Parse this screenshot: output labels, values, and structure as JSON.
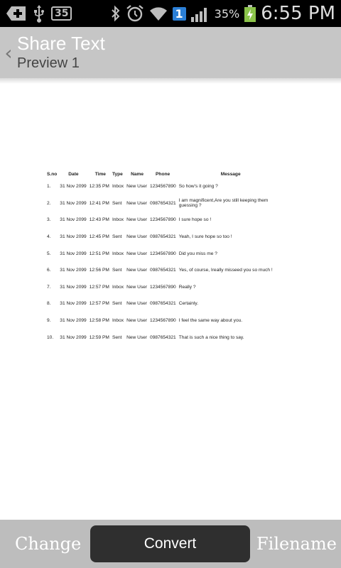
{
  "status_bar": {
    "notification_count": "35",
    "sim_badge": "1",
    "battery_percent": "35%",
    "time": "6:55 PM",
    "icons": [
      "add-icon",
      "usb-icon",
      "bluetooth-icon",
      "alarm-icon",
      "wifi-icon",
      "signal-icon",
      "battery-icon"
    ]
  },
  "action_bar": {
    "title": "Share Text",
    "subtitle": "Preview  1",
    "back_icon": "chevron-left-icon"
  },
  "table": {
    "headers": [
      "S.no",
      "Date",
      "Time",
      "Type",
      "Name",
      "Phone",
      "Message"
    ],
    "rows": [
      {
        "sno": "1.",
        "date": "31 Nov 2099",
        "time": "12:35 PM",
        "type": "Inbox",
        "name": "New User",
        "phone": "1234567890",
        "message": "So how's it going ?"
      },
      {
        "sno": "2.",
        "date": "31 Nov 2099",
        "time": "12:41 PM",
        "type": "Sent",
        "name": "New User",
        "phone": "0987654321",
        "message": "I am magnificent,Are you still keeping them guessing ?"
      },
      {
        "sno": "3.",
        "date": "31 Nov 2099",
        "time": "12:43 PM",
        "type": "Inbox",
        "name": "New User",
        "phone": "1234567890",
        "message": "I sure hope so !"
      },
      {
        "sno": "4.",
        "date": "31 Nov 2099",
        "time": "12:45 PM",
        "type": "Sent",
        "name": "New User",
        "phone": "0987654321",
        "message": "Yeah, I sure hope so too !"
      },
      {
        "sno": "5.",
        "date": "31 Nov 2099",
        "time": "12:51 PM",
        "type": "Inbox",
        "name": "New User",
        "phone": "1234567890",
        "message": "Did you miss me ?"
      },
      {
        "sno": "6.",
        "date": "31 Nov 2099",
        "time": "12:56 PM",
        "type": "Sent",
        "name": "New User",
        "phone": "0987654321",
        "message": "Yes, of course, Ireally misseed you so much !"
      },
      {
        "sno": "7.",
        "date": "31 Nov 2099",
        "time": "12:57 PM",
        "type": "Inbox",
        "name": "New User",
        "phone": "1234567890",
        "message": "Really ?"
      },
      {
        "sno": "8.",
        "date": "31 Nov 2099",
        "time": "12:57 PM",
        "type": "Sent",
        "name": "New User",
        "phone": "0987654321",
        "message": "Certainly."
      },
      {
        "sno": "9.",
        "date": "31 Nov 2099",
        "time": "12:58 PM",
        "type": "Inbox",
        "name": "New User",
        "phone": "1234567890",
        "message": "I feel the same way about you."
      },
      {
        "sno": "10.",
        "date": "31 Nov 2099",
        "time": "12:59 PM",
        "type": "Sent",
        "name": "New User",
        "phone": "0987654321",
        "message": "That is such a nice thing to say."
      }
    ]
  },
  "bottom_bar": {
    "change_label": "Change",
    "convert_label": "Convert",
    "filename_label": "Filename"
  }
}
